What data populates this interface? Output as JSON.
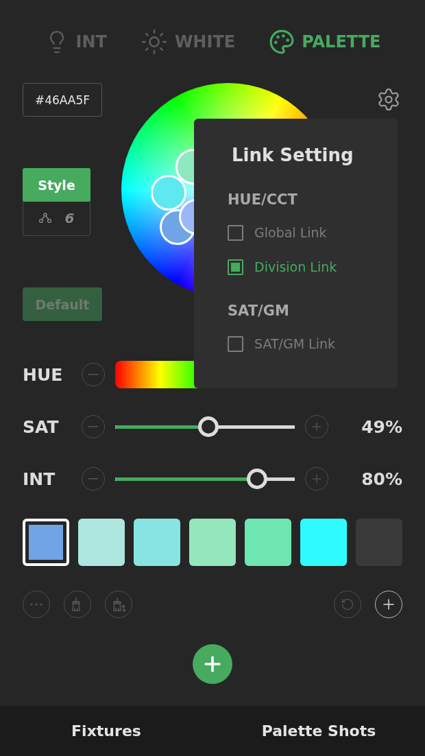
{
  "tabs": [
    {
      "label": "INT",
      "kind": "bulb",
      "selected": false
    },
    {
      "label": "WHITE",
      "kind": "sun",
      "selected": false
    },
    {
      "label": "PALETTE",
      "kind": "palette",
      "selected": true
    }
  ],
  "hex_field": {
    "value": "#46AA5F"
  },
  "style_card": {
    "label": "Style",
    "count": "6"
  },
  "default_button": {
    "label": "Default"
  },
  "link_popup": {
    "title": "Link Setting",
    "sections": [
      {
        "heading": "HUE/CCT",
        "options": [
          {
            "label": "Global Link",
            "checked": false
          },
          {
            "label": "Division Link",
            "checked": true
          }
        ]
      },
      {
        "heading": "SAT/GM",
        "options": [
          {
            "label": "SAT/GM Link",
            "checked": false
          }
        ]
      }
    ]
  },
  "sliders": [
    {
      "label": "HUE",
      "kind": "hue"
    },
    {
      "label": "SAT",
      "kind": "track",
      "level": 0.52,
      "reading": "49%"
    },
    {
      "label": "INT",
      "kind": "track",
      "level": 0.79,
      "reading": "80%"
    }
  ],
  "swatches": [
    {
      "color": "#6fa4e6",
      "selected": true
    },
    {
      "color": "#aee6e0",
      "selected": false
    },
    {
      "color": "#88e4e2",
      "selected": false
    },
    {
      "color": "#94e6bc",
      "selected": false
    },
    {
      "color": "#6ee6b2",
      "selected": false
    },
    {
      "color": "#2efaff",
      "selected": false
    },
    {
      "color": "#3a3a3a",
      "selected": false
    }
  ],
  "bottom_tabs": [
    {
      "label": "Fixtures"
    },
    {
      "label": "Palette Shots"
    }
  ]
}
